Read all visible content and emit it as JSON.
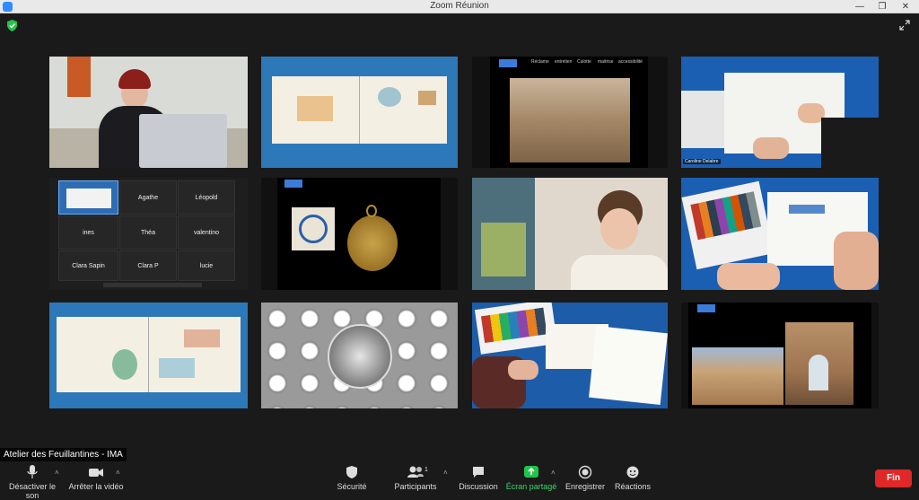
{
  "window": {
    "title": "Zoom Réunion",
    "minimize": "—",
    "maximize": "❐",
    "close": "✕"
  },
  "meeting": {
    "name_tag": "Atelier des Feuillantines - IMA"
  },
  "tiles": {
    "participants_grid": [
      "Agathe",
      "Léopold",
      "ines",
      "Théa",
      "valentino",
      "Clara Sapin",
      "Clara P",
      "lucie"
    ],
    "painter_label": "Caroline Delabre",
    "slide_tabs": [
      "Réclame",
      "entretien",
      "Culotte",
      "maitrise",
      "accessibilité"
    ]
  },
  "toolbar": {
    "mute_label": "Désactiver le son",
    "video_label": "Arrêter la vidéo",
    "security_label": "Sécurité",
    "participants_label": "Participants",
    "participants_count": "1",
    "chat_label": "Discussion",
    "share_label": "Écran partagé",
    "record_label": "Enregistrer",
    "reactions_label": "Réactions",
    "end_label": "Fin"
  },
  "colors": {
    "end_button": "#e02828",
    "share_icon": "#21c44a",
    "shield": "#25c44a"
  }
}
